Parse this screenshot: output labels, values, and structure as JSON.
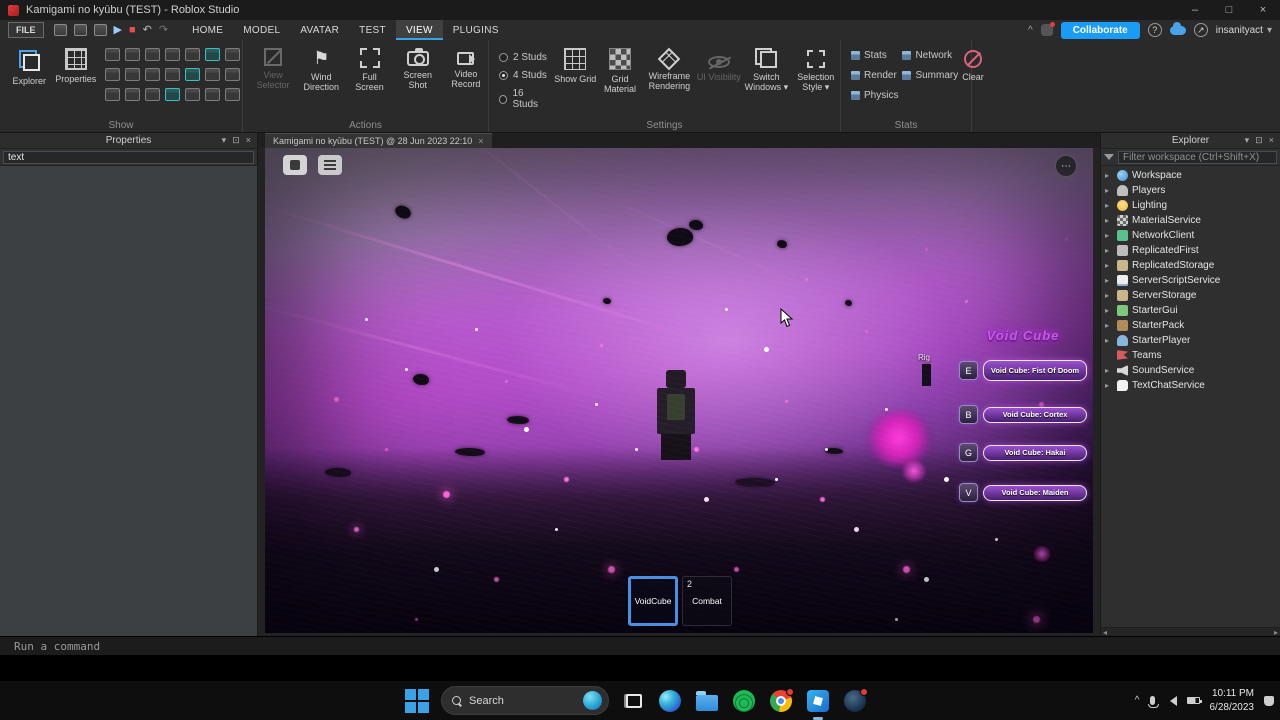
{
  "window": {
    "title": "Kamigami no kyūbu (TEST) - Roblox Studio"
  },
  "menubar": {
    "file": "FILE",
    "tabs": [
      "HOME",
      "MODEL",
      "AVATAR",
      "TEST",
      "VIEW",
      "PLUGINS"
    ],
    "active_tab": "VIEW",
    "collaborate": "Collaborate",
    "username": "insanityact"
  },
  "ribbon": {
    "group_labels": [
      "Show",
      "Actions",
      "Settings",
      "Stats"
    ],
    "show": {
      "explorer": "Explorer",
      "properties": "Properties"
    },
    "actions": {
      "view_selector": "View Selector",
      "wind_direction": "Wind Direction",
      "full_screen": "Full Screen",
      "screen_shot": "Screen Shot",
      "video_record": "Video Record"
    },
    "settings": {
      "studs": [
        "2 Studs",
        "4 Studs",
        "16 Studs"
      ],
      "selected_stud": "4 Studs",
      "show_grid": "Show Grid",
      "grid_material": "Grid Material",
      "wireframe_rendering": "Wireframe Rendering",
      "ui_visibility": "UI Visibility",
      "switch_windows": "Switch Windows",
      "selection_style": "Selection Style"
    },
    "stats": {
      "stats": "Stats",
      "render": "Render",
      "physics": "Physics",
      "network": "Network",
      "summary": "Summary",
      "clear": "Clear"
    }
  },
  "properties_panel": {
    "title": "Properties",
    "filter_value": "text"
  },
  "viewport": {
    "tab_title": "Kamigami no kyūbu (TEST) @ 28 Jun 2023 22:10",
    "game_ui": {
      "skill_title": "Void Cube",
      "skills": [
        {
          "key": "E",
          "label": "Void Cube: Fist Of Doom"
        },
        {
          "key": "B",
          "label": "Void Cube: Cortex"
        },
        {
          "key": "G",
          "label": "Void Cube: Hakai"
        },
        {
          "key": "V",
          "label": "Void Cube: Maiden"
        }
      ],
      "hotbar": [
        {
          "number": "",
          "label": "VoidCube"
        },
        {
          "number": "2",
          "label": "Combat"
        }
      ],
      "rig_label": "Rig"
    }
  },
  "explorer_panel": {
    "title": "Explorer",
    "filter_placeholder": "Filter workspace (Ctrl+Shift+X)",
    "items": [
      "Workspace",
      "Players",
      "Lighting",
      "MaterialService",
      "NetworkClient",
      "ReplicatedFirst",
      "ReplicatedStorage",
      "ServerScriptService",
      "ServerStorage",
      "StarterGui",
      "StarterPack",
      "StarterPlayer",
      "Teams",
      "SoundService",
      "TextChatService"
    ]
  },
  "command_bar": {
    "text": "Run a command"
  },
  "taskbar": {
    "search": "Search",
    "time": "10:11 PM",
    "date": "6/28/2023"
  },
  "icons": {
    "close": "×",
    "minimize": "–",
    "maximize": "□",
    "chevron_down": "▾",
    "chevron_up": "^",
    "expand": "▸",
    "left": "◂",
    "right": "▸",
    "dots": "⋯",
    "play": "▶",
    "stop": "■",
    "undo": "↶",
    "redo": "↷",
    "flag": "⚑",
    "help": "?",
    "share": "↗",
    "dock": "⊡"
  },
  "colors": {
    "collaborate_blue": "#1a9bf5",
    "hotbar_selection_blue": "#4a90e2",
    "void_purple": "#9a4fd0",
    "scene_magenta": "#d024b8"
  }
}
